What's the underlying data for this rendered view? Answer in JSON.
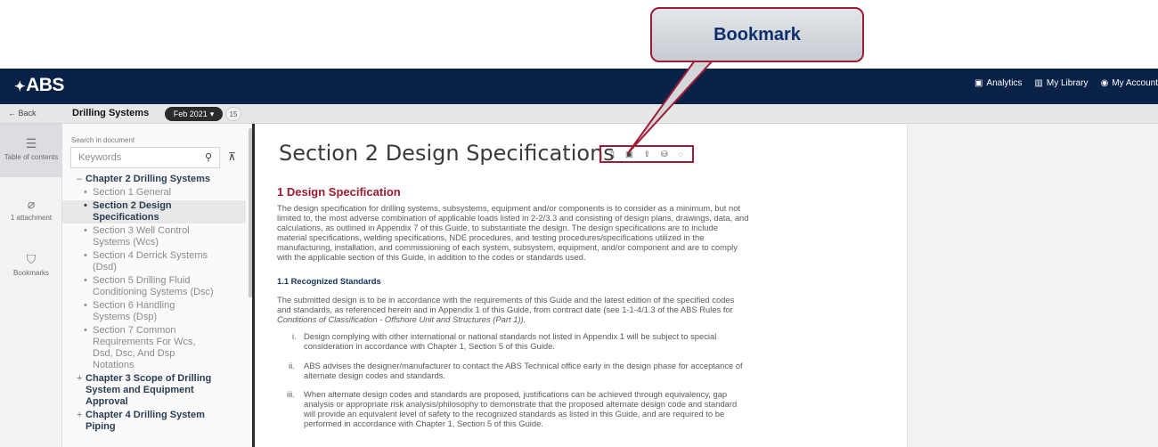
{
  "callout": {
    "label": "Bookmark"
  },
  "header": {
    "logo_text": "ABS",
    "analytics": "Analytics",
    "library": "My Library",
    "account": "My Account"
  },
  "subbar": {
    "back": "← Back",
    "title": "Drilling Systems",
    "edition": "Feb 2021",
    "count": "15"
  },
  "rail": {
    "toc_label": "Table of contents",
    "attachment_label": "1 attachment",
    "bookmarks_label": "Bookmarks"
  },
  "search": {
    "label": "Search in document",
    "placeholder": "Keywords"
  },
  "toc": {
    "ch2": "Chapter 2 Drilling Systems",
    "s1": "Section 1 General",
    "s2a": "Section 2 Design",
    "s2b": "Specifications",
    "s3a": "Section 3 Well Control",
    "s3b": "Systems (Wcs)",
    "s4a": "Section 4 Derrick Systems",
    "s4b": "(Dsd)",
    "s5a": "Section 5 Drilling Fluid",
    "s5b": "Conditioning Systems (Dsc)",
    "s6a": "Section 6 Handling",
    "s6b": "Systems (Dsp)",
    "s7a": "Section 7 Common",
    "s7b": "Requirements For Wcs,",
    "s7c": "Dsd, Dsc, And Dsp",
    "s7d": "Notations",
    "ch3a": "Chapter 3 Scope of Drilling",
    "ch3b": "System and Equipment",
    "ch3c": "Approval",
    "ch4a": "Chapter 4 Drilling System",
    "ch4b": "Piping"
  },
  "content": {
    "title": "Section 2 Design Specifications",
    "h2": "1 Design Specification",
    "p1": [
      "The design specification for drilling systems, subsystems, equipment and/or components is to consider as a minimum, but not",
      "limited to, the most adverse combination of applicable loads listed in 2-2/3.3 and consisting of design plans, drawings, data, and",
      "calculations, as outlined in Appendix 7 of this Guide, to substantiate the design. The design specifications are to include",
      "material specifications, welding specifications, NDE procedures, and testing procedures/specifications utilized in the",
      "manufacturing, installation, and commissioning of each system, subsystem, equipment, and/or component and are to comply",
      "with the applicable section of this Guide, in addition to the codes or standards used."
    ],
    "h3": "1.1 Recognized Standards",
    "p2": [
      "The submitted design is to be in accordance with the requirements of this Guide and the latest edition of the specified codes",
      "and standards, as referenced herein and in Appendix 1 of this Guide, from contract date (see 1-1-4/1.3 of the ABS Rules for",
      "Conditions of Classification - Offshore Unit and Structures (Part 1))."
    ],
    "items": [
      {
        "num": "i.",
        "lines": [
          "Design complying with other international or national standards not listed in Appendix 1 will be subject to special",
          "consideration in accordance with Chapter 1, Section 5 of this Guide."
        ]
      },
      {
        "num": "ii.",
        "lines": [
          "ABS advises the designer/manufacturer to contact the ABS Technical office early in the design phase for acceptance of",
          "alternate design codes and standards."
        ]
      },
      {
        "num": "iii.",
        "lines": [
          "When alternate design codes and standards are proposed, justifications can be achieved through equivalency, gap",
          "analysis or appropriate risk analysis/philosophy to demonstrate that the proposed alternate design code and standard",
          "will provide an equivalent level of safety to the recognized standards as listed in this Guide, and are required to be",
          "performed in accordance with Chapter 1, Section 5 of this Guide."
        ]
      }
    ]
  },
  "colors": {
    "navy": "#0a2148",
    "crimson": "#9b1b30",
    "callout_border": "#a01c36"
  }
}
